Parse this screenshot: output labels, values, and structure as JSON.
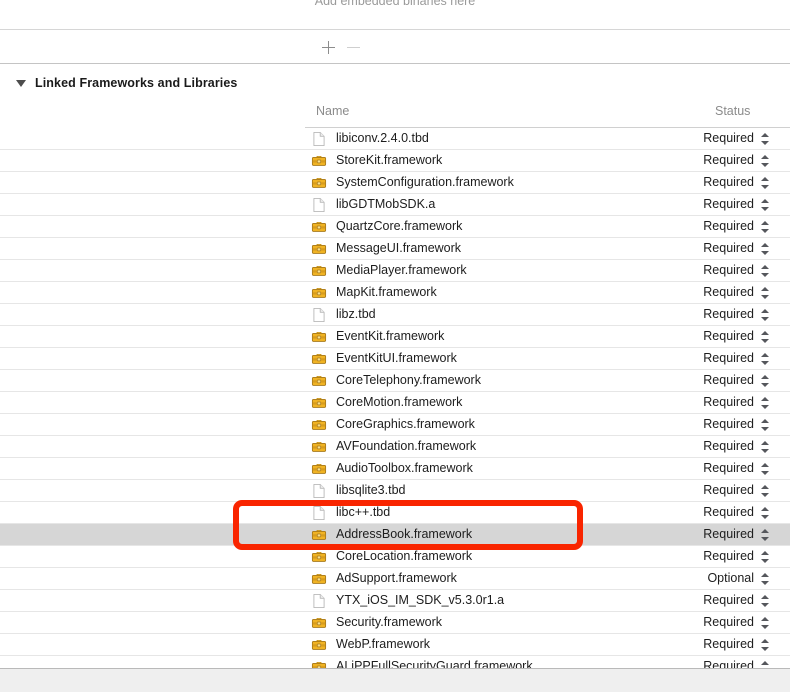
{
  "embedded_binaries": {
    "placeholder": "Add embedded binaries here",
    "add_label": "+",
    "remove_label": "−"
  },
  "section": {
    "title": "Linked Frameworks and Libraries",
    "expanded": true
  },
  "table": {
    "columns": {
      "name": "Name",
      "status": "Status"
    },
    "rows": [
      {
        "name": "libiconv.2.4.0.tbd",
        "icon": "document-icon",
        "status": "Required",
        "selected": false
      },
      {
        "name": "StoreKit.framework",
        "icon": "framework-icon",
        "status": "Required",
        "selected": false
      },
      {
        "name": "SystemConfiguration.framework",
        "icon": "framework-icon",
        "status": "Required",
        "selected": false
      },
      {
        "name": "libGDTMobSDK.a",
        "icon": "document-icon",
        "status": "Required",
        "selected": false
      },
      {
        "name": "QuartzCore.framework",
        "icon": "framework-icon",
        "status": "Required",
        "selected": false
      },
      {
        "name": "MessageUI.framework",
        "icon": "framework-icon",
        "status": "Required",
        "selected": false
      },
      {
        "name": "MediaPlayer.framework",
        "icon": "framework-icon",
        "status": "Required",
        "selected": false
      },
      {
        "name": "MapKit.framework",
        "icon": "framework-icon",
        "status": "Required",
        "selected": false
      },
      {
        "name": "libz.tbd",
        "icon": "document-icon",
        "status": "Required",
        "selected": false
      },
      {
        "name": "EventKit.framework",
        "icon": "framework-icon",
        "status": "Required",
        "selected": false
      },
      {
        "name": "EventKitUI.framework",
        "icon": "framework-icon",
        "status": "Required",
        "selected": false
      },
      {
        "name": "CoreTelephony.framework",
        "icon": "framework-icon",
        "status": "Required",
        "selected": false
      },
      {
        "name": "CoreMotion.framework",
        "icon": "framework-icon",
        "status": "Required",
        "selected": false
      },
      {
        "name": "CoreGraphics.framework",
        "icon": "framework-icon",
        "status": "Required",
        "selected": false
      },
      {
        "name": "AVFoundation.framework",
        "icon": "framework-icon",
        "status": "Required",
        "selected": false
      },
      {
        "name": "AudioToolbox.framework",
        "icon": "framework-icon",
        "status": "Required",
        "selected": false
      },
      {
        "name": "libsqlite3.tbd",
        "icon": "document-icon",
        "status": "Required",
        "selected": false
      },
      {
        "name": "libc++.tbd",
        "icon": "document-icon",
        "status": "Required",
        "selected": false
      },
      {
        "name": "AddressBook.framework",
        "icon": "framework-icon",
        "status": "Required",
        "selected": true
      },
      {
        "name": "CoreLocation.framework",
        "icon": "framework-icon",
        "status": "Required",
        "selected": false
      },
      {
        "name": "AdSupport.framework",
        "icon": "framework-icon",
        "status": "Optional",
        "selected": false
      },
      {
        "name": "YTX_iOS_IM_SDK_v5.3.0r1.a",
        "icon": "document-icon",
        "status": "Required",
        "selected": false
      },
      {
        "name": "Security.framework",
        "icon": "framework-icon",
        "status": "Required",
        "selected": false
      },
      {
        "name": "WebP.framework",
        "icon": "framework-icon",
        "status": "Required",
        "selected": false
      },
      {
        "name": "ALiPPFullSecurityGuard.framework",
        "icon": "framework-icon",
        "status": "Required",
        "selected": false
      }
    ]
  },
  "annotation": {
    "color": "#f92500",
    "target_row": "libc++.tbd"
  }
}
